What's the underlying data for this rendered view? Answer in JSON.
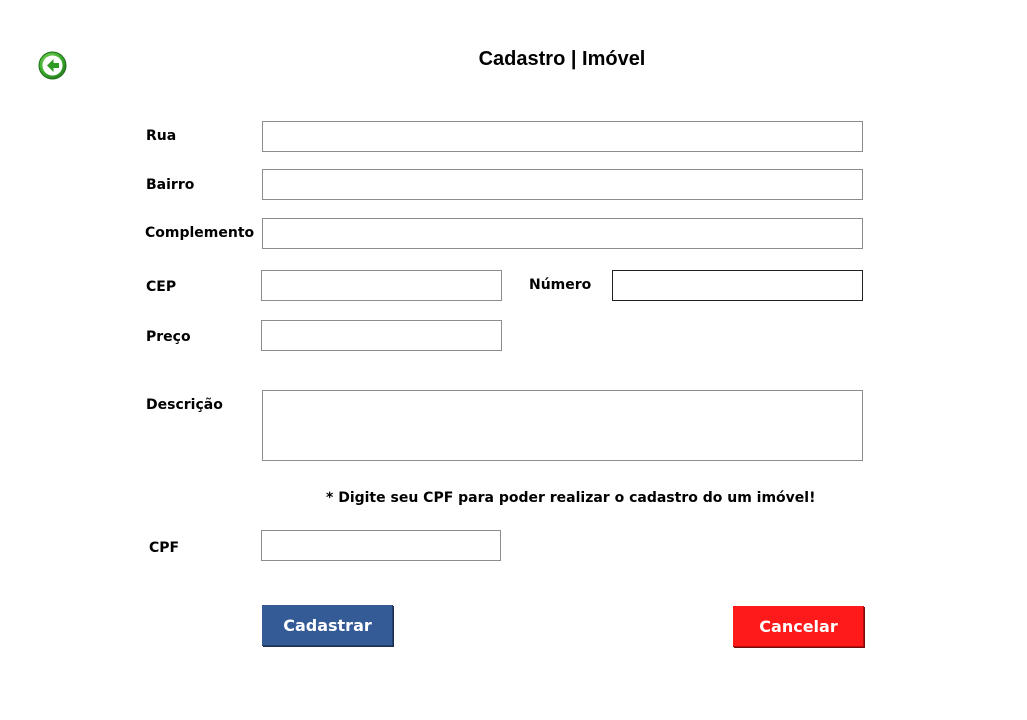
{
  "header": {
    "title": "Cadastro | Imóvel",
    "back_icon": "arrow-left-circle-icon",
    "back_icon_color": "#3aa335"
  },
  "form": {
    "rua": {
      "label": "Rua",
      "value": "",
      "placeholder": ""
    },
    "bairro": {
      "label": "Bairro",
      "value": "",
      "placeholder": ""
    },
    "complemento": {
      "label": "Complemento",
      "value": "",
      "placeholder": ""
    },
    "cep": {
      "label": "CEP",
      "value": "",
      "placeholder": ""
    },
    "numero": {
      "label": "Número",
      "value": "",
      "placeholder": ""
    },
    "preco": {
      "label": "Preço",
      "value": "",
      "placeholder": ""
    },
    "descricao": {
      "label": "Descrição",
      "value": "",
      "placeholder": ""
    },
    "note": "* Digite seu CPF para poder realizar o cadastro do um imóvel!",
    "cpf": {
      "label": "CPF",
      "value": "",
      "placeholder": ""
    }
  },
  "actions": {
    "submit_label": "Cadastrar",
    "submit_color": "#355b97",
    "cancel_label": "Cancelar",
    "cancel_color": "#fe1a1a"
  }
}
